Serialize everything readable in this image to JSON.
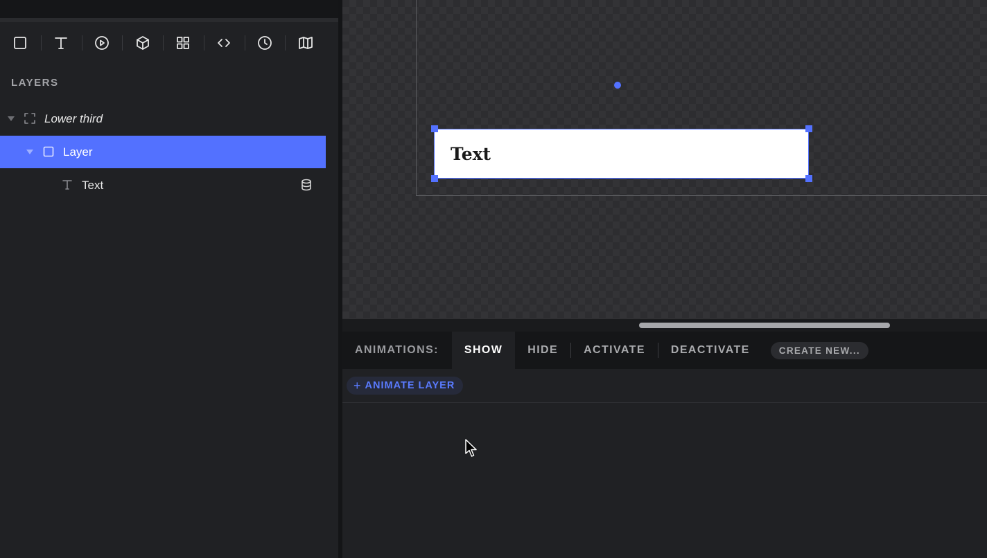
{
  "toolbar": {
    "tools": [
      {
        "name": "rectangle-tool",
        "icon": "square-icon"
      },
      {
        "name": "text-tool",
        "icon": "text-t-icon"
      },
      {
        "name": "media-tool",
        "icon": "play-circle-icon"
      },
      {
        "name": "3d-tool",
        "icon": "cube-icon"
      },
      {
        "name": "grid-tool",
        "icon": "grid-icon"
      },
      {
        "name": "code-tool",
        "icon": "code-brackets-icon"
      },
      {
        "name": "clock-tool",
        "icon": "clock-icon"
      },
      {
        "name": "map-tool",
        "icon": "map-icon"
      }
    ]
  },
  "layers": {
    "title": "LAYERS",
    "items": [
      {
        "label": "Lower third",
        "icon": "frame-corners-icon",
        "italic": true,
        "selected": false
      },
      {
        "label": "Layer",
        "icon": "square-icon",
        "selected": true
      },
      {
        "label": "Text",
        "icon": "text-t-icon",
        "selected": false,
        "badge_icon": "database-icon"
      }
    ]
  },
  "canvas": {
    "text_box_label": "Text",
    "accent_color": "#5371ff"
  },
  "animations": {
    "label": "ANIMATIONS:",
    "tabs": [
      {
        "label": "SHOW",
        "active": true
      },
      {
        "label": "HIDE",
        "active": false
      },
      {
        "label": "ACTIVATE",
        "active": false
      },
      {
        "label": "DEACTIVATE",
        "active": false
      }
    ],
    "create_new_label": "CREATE NEW...",
    "animate_layer_label": "ANIMATE LAYER"
  }
}
